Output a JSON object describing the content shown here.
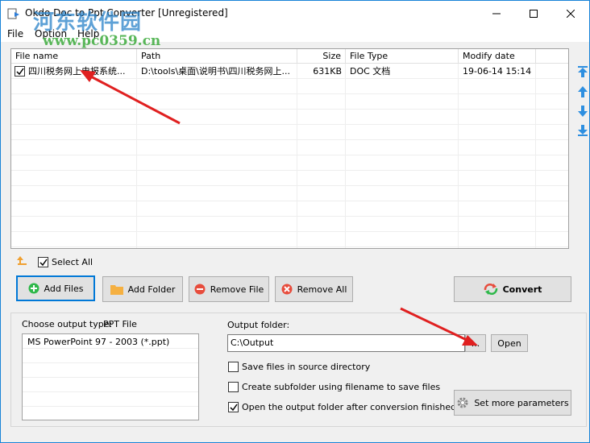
{
  "window": {
    "title": "Okdo Doc to Ppt Converter [Unregistered]",
    "controls": {
      "minimize": "—",
      "maximize": "☐",
      "close": "✕"
    }
  },
  "watermark": {
    "line1": "河东软件园",
    "line2": "www.pc0359.cn"
  },
  "menu": {
    "file": "File",
    "option": "Option",
    "help": "Help"
  },
  "file_table": {
    "columns": [
      "File name",
      "Path",
      "Size",
      "File Type",
      "Modify date"
    ],
    "rows": [
      {
        "checked": true,
        "name": "四川税务网上电报系统...",
        "path": "D:\\tools\\桌面\\说明书\\四川税务网上...",
        "size": "631KB",
        "type": "DOC 文档",
        "date": "19-06-14 15:14"
      }
    ]
  },
  "side_controls": {
    "icons": [
      "move-top-icon",
      "move-up-icon",
      "move-down-icon",
      "move-bottom-icon"
    ]
  },
  "select_all": {
    "label": "Select All",
    "checked": true
  },
  "buttons": {
    "add_files": "Add Files",
    "add_folder": "Add Folder",
    "remove_file": "Remove File",
    "remove_all": "Remove All",
    "convert": "Convert"
  },
  "output": {
    "type_label": "Choose output type:",
    "type_value": "PPT File",
    "types": [
      "MS PowerPoint 97 - 2003 (*.ppt)"
    ],
    "folder_label": "Output folder:",
    "folder_value": "C:\\Output",
    "browse": "...",
    "open": "Open",
    "options": [
      {
        "label": "Save files in source directory",
        "checked": false
      },
      {
        "label": "Create subfolder using filename to save files",
        "checked": false
      },
      {
        "label": "Open the output folder after conversion finished",
        "checked": true
      }
    ],
    "more_params": "Set more parameters"
  },
  "colors": {
    "accent": "#0078d7",
    "annotation_arrow": "#e02020",
    "title_border": "#1883d7"
  }
}
